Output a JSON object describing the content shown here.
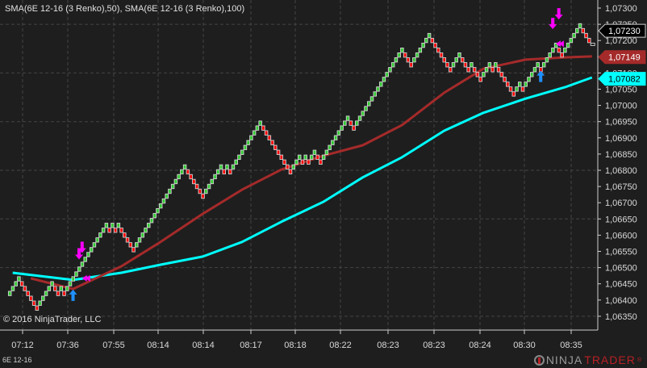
{
  "indicator_label": "SMA(6E 12-16 (3 Renko),50), SMA(6E 12-16 (3 Renko),100)",
  "copyright": "© 2016 NinjaTrader, LLC",
  "instrument": "6E 12-16",
  "logo": {
    "part1": "NINJA",
    "part2": "TRADER",
    "reg": "®"
  },
  "y_axis": {
    "min": 1.0633,
    "max": 1.0732,
    "labels": [
      "1,07300",
      "1,07250",
      "1,07200",
      "1,07150",
      "1,07100",
      "1,07050",
      "1,07000",
      "1,06950",
      "1,06900",
      "1,06850",
      "1,06800",
      "1,06750",
      "1,06700",
      "1,06650",
      "1,06600",
      "1,06550",
      "1,06500",
      "1,06450",
      "1,06400",
      "1,06350"
    ]
  },
  "x_axis": {
    "labels": [
      "07:12",
      "07:36",
      "07:55",
      "08:14",
      "08:14",
      "08:17",
      "08:18",
      "08:22",
      "08:23",
      "08:23",
      "08:24",
      "08:30",
      "08:35"
    ]
  },
  "price_markers": [
    {
      "label": "1,07230",
      "value": 1.0723,
      "bg": "#000000",
      "fg": "#ffffff"
    },
    {
      "label": "1,07149",
      "value": 1.07149,
      "bg": "#a52a2a",
      "fg": "#ffffff"
    },
    {
      "label": "1,07082",
      "value": 1.07082,
      "bg": "#00ffff",
      "fg": "#000000"
    }
  ],
  "colors": {
    "up": "#32cd32",
    "down": "#ff0000",
    "outline": "#d3d3d3",
    "sma50": "#a52a2a",
    "sma100": "#00ffff",
    "grid": "#444444",
    "signal_buy": "#1e90ff",
    "signal_sell": "#ff00ff"
  },
  "renko": {
    "start_price": 1.06412,
    "brick_size": 0.00015,
    "runs": [
      4,
      -6,
      5,
      -2,
      1,
      -1,
      14,
      -1,
      1,
      -1,
      1,
      -5,
      17,
      -6,
      6,
      -1,
      1,
      -1,
      10,
      -10,
      3,
      -1,
      1,
      -1,
      2,
      -2,
      9,
      -2,
      16,
      -3,
      6,
      -7,
      3,
      -3,
      1,
      -3,
      3,
      -1,
      1,
      -6,
      2,
      -1,
      5,
      -1,
      5,
      -2,
      6,
      -3
    ]
  },
  "sma50": [
    [
      7,
      1.06467
    ],
    [
      21,
      1.06434
    ],
    [
      37,
      1.06504
    ],
    [
      50,
      1.06579
    ],
    [
      64,
      1.06666
    ],
    [
      77,
      1.0674
    ],
    [
      90,
      1.06802
    ],
    [
      104,
      1.06845
    ],
    [
      117,
      1.06877
    ],
    [
      130,
      1.06939
    ],
    [
      144,
      1.07039
    ],
    [
      157,
      1.07113
    ],
    [
      171,
      1.07141
    ],
    [
      184,
      1.07148
    ],
    [
      193,
      1.07151
    ]
  ],
  "sma100": [
    [
      1,
      1.06484
    ],
    [
      21,
      1.06462
    ],
    [
      37,
      1.06484
    ],
    [
      50,
      1.06509
    ],
    [
      64,
      1.06534
    ],
    [
      77,
      1.06579
    ],
    [
      90,
      1.06641
    ],
    [
      104,
      1.06703
    ],
    [
      117,
      1.06778
    ],
    [
      130,
      1.0684
    ],
    [
      144,
      1.06922
    ],
    [
      157,
      1.06977
    ],
    [
      171,
      1.07021
    ],
    [
      184,
      1.07056
    ],
    [
      193,
      1.07086
    ]
  ],
  "signals": [
    {
      "type": "buy",
      "brick": 21,
      "price": 1.06432
    },
    {
      "type": "sell",
      "brick": 23,
      "price": 1.06525
    },
    {
      "type": "sell",
      "brick": 24,
      "price": 1.06545
    },
    {
      "type": "exit",
      "brick": 24,
      "price": 1.06467
    },
    {
      "type": "buy",
      "brick": 176,
      "price": 1.07107
    },
    {
      "type": "sell",
      "brick": 180,
      "price": 1.07235
    },
    {
      "type": "sell",
      "brick": 182,
      "price": 1.07265
    },
    {
      "type": "exit",
      "brick": 181,
      "price": 1.0719
    }
  ]
}
